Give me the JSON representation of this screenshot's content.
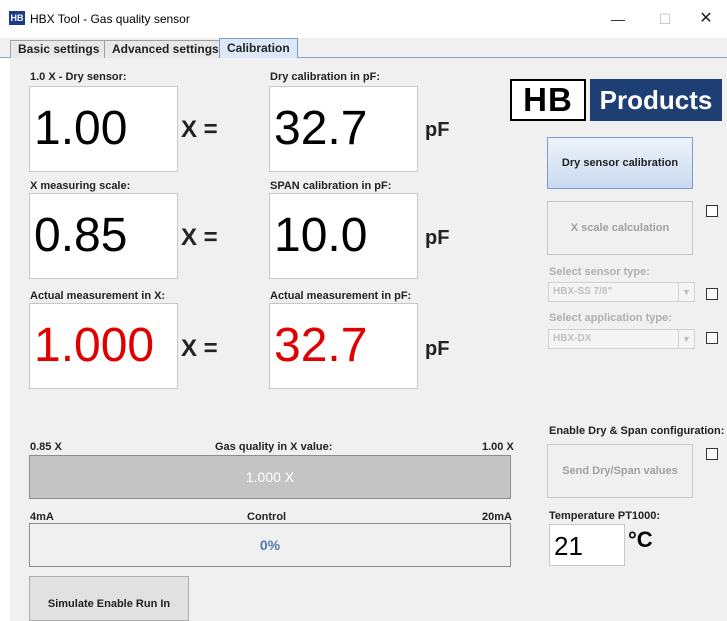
{
  "window": {
    "app_icon": "HB",
    "title": "HBX Tool - Gas quality sensor",
    "minimize": "—",
    "maximize": "☐",
    "close": "✕"
  },
  "tabs": [
    {
      "label": "Basic settings"
    },
    {
      "label": "Advanced settings"
    },
    {
      "label": "Calibration"
    }
  ],
  "logo": {
    "left": "HB",
    "right": "Products"
  },
  "dry": {
    "x_label": "1.0 X - Dry sensor:",
    "x_value": "1.00",
    "pf_label": "Dry calibration in pF:",
    "pf_value": "32.7"
  },
  "scale": {
    "x_label": "X measuring scale:",
    "x_value": "0.85",
    "pf_label": "SPAN calibration in pF:",
    "pf_value": "10.0"
  },
  "actual": {
    "x_label": "Actual measurement in X:",
    "x_value": "1.000",
    "pf_label": "Actual measurement in pF:",
    "pf_value": "32.7"
  },
  "operators": {
    "x_eq": "X  =",
    "unit_pf": "pF"
  },
  "buttons": {
    "dry_calibration": "Dry sensor calibration",
    "x_scale": "X scale calculation",
    "send_values": "Send Dry/Span values",
    "simulate": "Simulate Enable Run In"
  },
  "sensor_type": {
    "label": "Select sensor type:",
    "value": "HBX-SS 7/8\""
  },
  "application_type": {
    "label": "Select application type:",
    "value": "HBX-DX"
  },
  "enable_config_label": "Enable Dry & Span configuration:",
  "gas_quality": {
    "min_label": "0.85 X",
    "title": "Gas quality in X value:",
    "max_label": "1.00 X",
    "value_text": "1.000 X"
  },
  "control": {
    "min_label": "4mA",
    "title": "Control",
    "max_label": "20mA",
    "value_text": "0%",
    "level_percent": 0
  },
  "temperature": {
    "label": "Temperature PT1000:",
    "value": "21",
    "unit": "°C"
  },
  "colors": {
    "measurement_red": "#e00000",
    "logo_blue": "#1d3f73",
    "control_text": "#5578a8"
  }
}
